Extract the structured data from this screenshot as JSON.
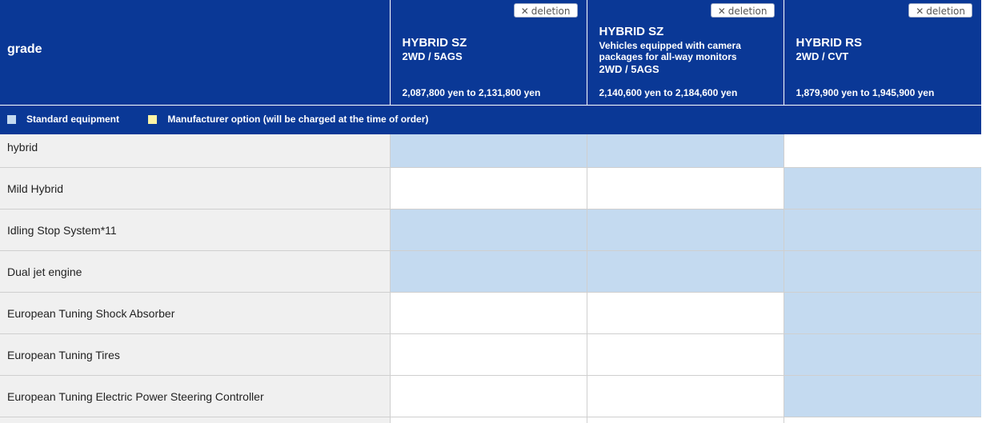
{
  "header": {
    "grade_label": "grade",
    "delete_label": "deletion",
    "delete_icon": "close-icon",
    "grades": [
      {
        "name": "HYBRID SZ",
        "note": "",
        "drive": "2WD / 5AGS",
        "price": "2,087,800 yen to 2,131,800 yen"
      },
      {
        "name": "HYBRID SZ",
        "note": "Vehicles equipped with camera packages for all-way monitors",
        "drive": "2WD / 5AGS",
        "price": "2,140,600 yen to 2,184,600 yen"
      },
      {
        "name": "HYBRID RS",
        "note": "",
        "drive": "2WD / CVT",
        "price": "1,879,900 yen to 1,945,900 yen"
      }
    ]
  },
  "legend": {
    "standard_label": "Standard equipment",
    "standard_color": "#c4daf0",
    "option_label": "Manufacturer option (will be charged at the time of order)",
    "option_color": "#fdf3a4"
  },
  "colors": {
    "header_bg": "#0a3896",
    "row_label_bg": "#f0f0f0",
    "standard": "#c4daf0"
  },
  "rows": [
    {
      "label": "hybrid",
      "cells": [
        "standard",
        "standard",
        "none"
      ]
    },
    {
      "label": "Mild Hybrid",
      "cells": [
        "none",
        "none",
        "standard"
      ]
    },
    {
      "label": "Idling Stop System*11",
      "cells": [
        "standard",
        "standard",
        "standard"
      ]
    },
    {
      "label": "Dual jet engine",
      "cells": [
        "standard",
        "standard",
        "standard"
      ]
    },
    {
      "label": "European Tuning Shock Absorber",
      "cells": [
        "none",
        "none",
        "standard"
      ]
    },
    {
      "label": "European Tuning Tires",
      "cells": [
        "none",
        "none",
        "standard"
      ]
    },
    {
      "label": "European Tuning Electric Power Steering Controller",
      "cells": [
        "none",
        "none",
        "standard"
      ]
    }
  ]
}
